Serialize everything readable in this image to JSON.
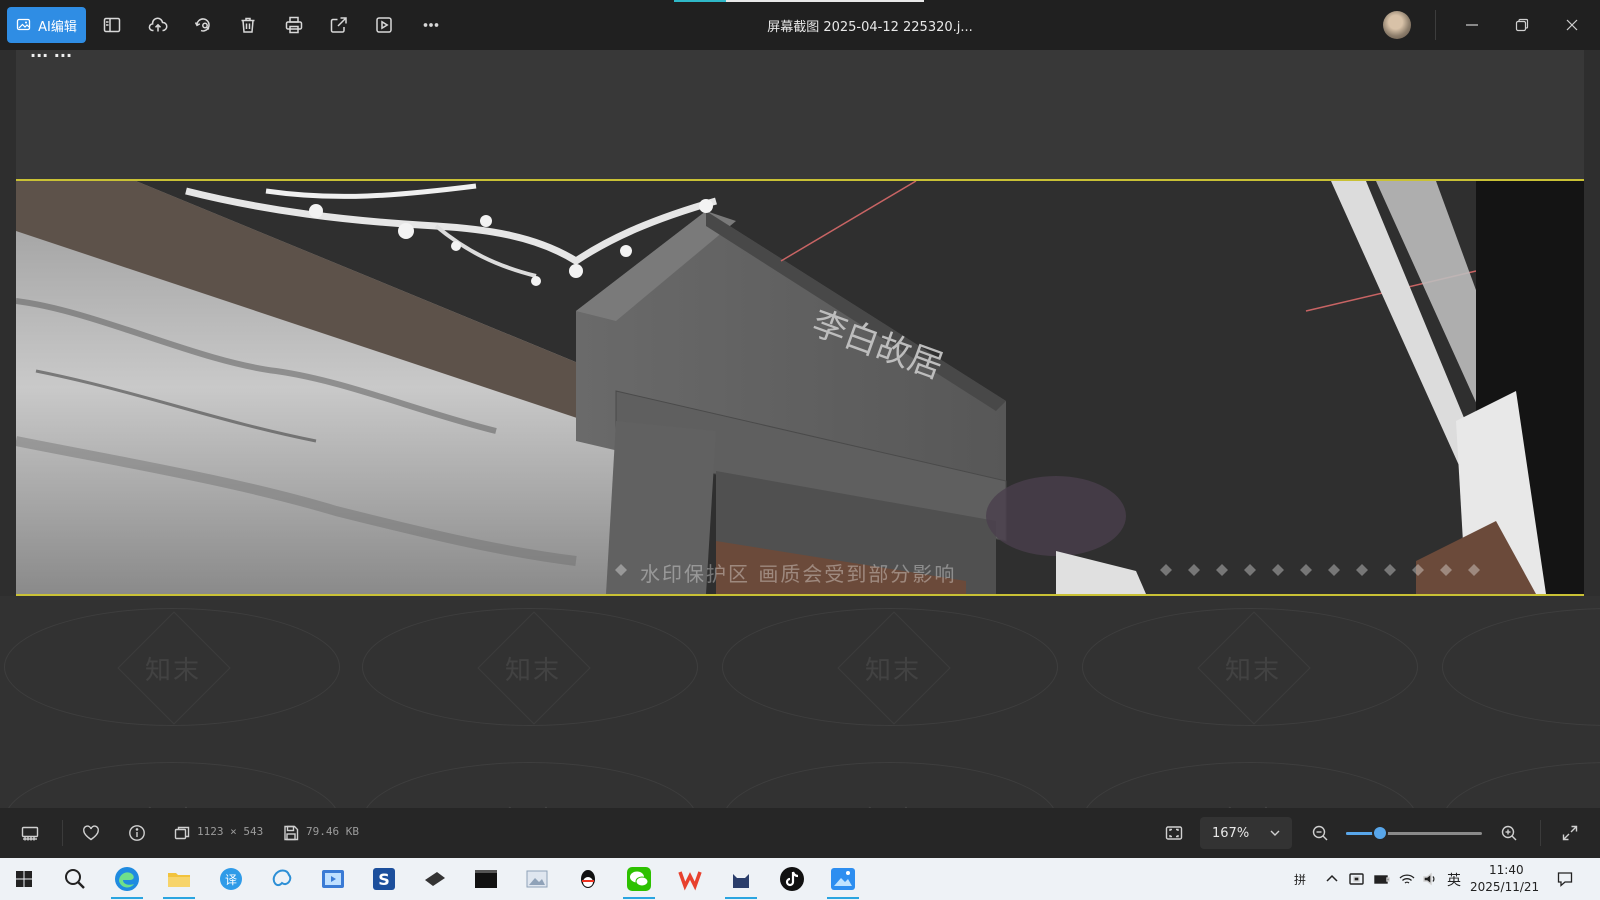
{
  "titlebar": {
    "ai_edit_label": "AI编辑",
    "file_title": "屏幕截图 2025-04-12 225320.j...",
    "tools": [
      "sidebar-icon",
      "cloud-upload-icon",
      "rotate-icon",
      "trash-icon",
      "print-icon",
      "share-icon",
      "slideshow-icon",
      "more-icon"
    ],
    "window_controls": [
      "minimize-icon",
      "restore-icon",
      "close-icon"
    ]
  },
  "image": {
    "top_partial_text": "...  ...",
    "sign_text": "李白故居",
    "protect_watermark": "水印保护区  画质会受到部分影响",
    "repeat_watermark": "知末"
  },
  "statusbar": {
    "dimensions": "1123 × 543",
    "filesize": "79.46 KB",
    "zoom": "167%",
    "zoom_level": 0.25
  },
  "taskbar": {
    "apps": [
      "windows-start-icon",
      "search-icon",
      "edge-icon",
      "file-explorer-icon",
      "translate-icon",
      "ai-app-icon",
      "video-app-icon",
      "sketchup-icon",
      "ink-app-icon",
      "terminal-icon",
      "photos-app-icon",
      "qq-icon",
      "wechat-icon",
      "wps-icon",
      "cat-app-icon",
      "tiktok-icon",
      "image-viewer-icon"
    ],
    "ime_label": "拼",
    "lang": "英",
    "time": "11:40",
    "date": "2025/11/21"
  },
  "colors": {
    "accent": "#2f8de4",
    "scene_border": "#c9c135",
    "titlebar_bg": "#202020"
  }
}
